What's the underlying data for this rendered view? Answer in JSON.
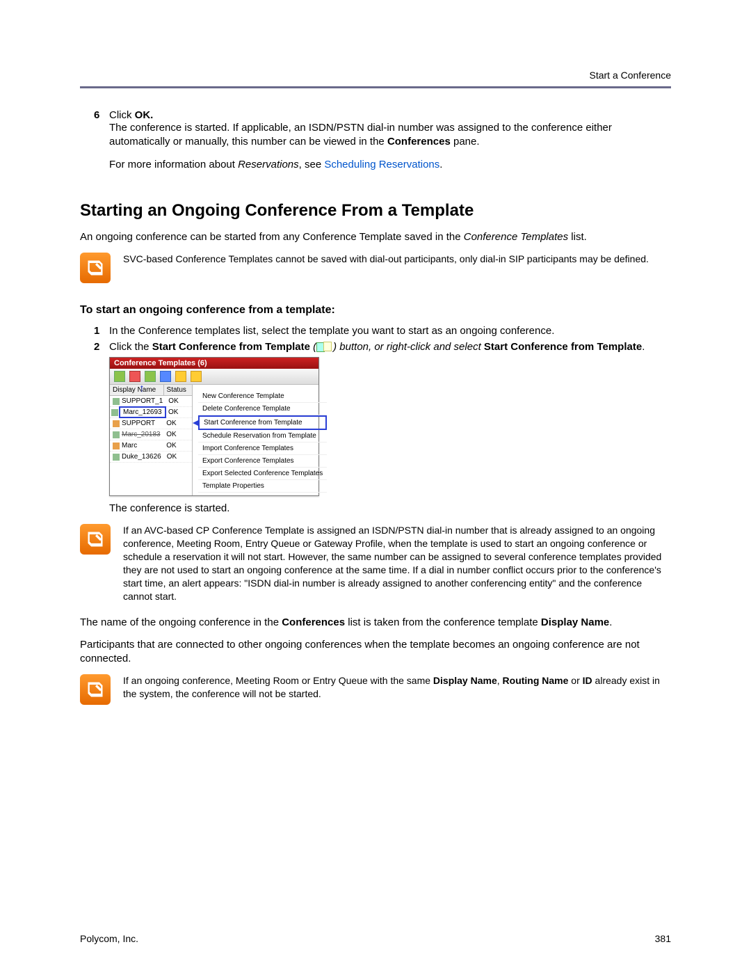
{
  "header": {
    "section": "Start a Conference"
  },
  "step6": {
    "num": "6",
    "label_prefix": "Click ",
    "label_bold": "OK.",
    "p1_a": "The conference is started. If applicable, an ISDN/PSTN dial-in number was assigned to the conference either automatically or manually, this number can be viewed in the ",
    "p1_bold": "Conferences",
    "p1_b": " pane.",
    "p2_a": "For more information about ",
    "p2_italic": "Reservations",
    "p2_b": ", see ",
    "p2_link": "Scheduling Reservations",
    "p2_c": "."
  },
  "h2": "Starting an Ongoing Conference From a Template",
  "intro_a": "An ongoing conference can be started from any Conference Template saved in the ",
  "intro_italic": "Conference Templates",
  "intro_b": " list.",
  "note1": "SVC-based Conference Templates cannot be saved with dial-out participants, only dial-in SIP participants may be defined.",
  "subhead": "To start an ongoing conference from a template:",
  "step1": {
    "num": "1",
    "text": "In the Conference templates list, select the template you want to start as an ongoing conference."
  },
  "step2": {
    "num": "2",
    "a": "Click the ",
    "b_bold": "Start Conference from Template",
    "c": " (",
    "d": ") button, or right-click and select ",
    "e_bold": "Start Conference from Template",
    "f": "."
  },
  "mock": {
    "title": "Conference Templates (6)",
    "col1": "Display Name",
    "col2": "Status",
    "rows": [
      {
        "name": "SUPPORT_1",
        "status": "OK"
      },
      {
        "name": "Marc_12693",
        "status": "OK"
      },
      {
        "name": "SUPPORT",
        "status": "OK"
      },
      {
        "name": "Marc_20183",
        "status": "OK"
      },
      {
        "name": "Marc",
        "status": "OK"
      },
      {
        "name": "Duke_13626",
        "status": "OK"
      }
    ],
    "menu": [
      "New Conference Template",
      "Delete Conference Template",
      "Start Conference from Template",
      "Schedule Reservation from Template",
      "Import Conference Templates",
      "Export Conference Templates",
      "Export Selected Conference Templates",
      "Template Properties"
    ]
  },
  "started": "The conference is started.",
  "note2": "If an AVC-based CP Conference Template is assigned an ISDN/PSTN dial-in number that is already assigned to an ongoing conference, Meeting Room, Entry Queue or Gateway Profile, when the template is used to start an ongoing conference or schedule a reservation it will not start. However, the same number can be assigned to several conference templates provided they are not used to start an ongoing conference at the same time. If a dial in number conflict occurs prior to the conference's start time, an alert appears: \"ISDN dial-in number is already assigned to another conferencing entity\" and the conference cannot start.",
  "p_after2_a": "The name of the ongoing conference in the ",
  "p_after2_bold1": "Conferences",
  "p_after2_b": " list is taken from the conference template ",
  "p_after2_bold2": "Display Name",
  "p_after2_c": ".",
  "p_after3": "Participants that are connected to other ongoing conferences when the template becomes an ongoing conference are not connected.",
  "note3_a": "If an ongoing conference, Meeting Room or Entry Queue with the same ",
  "note3_b1": "Display Name",
  "note3_b": ", ",
  "note3_b2": "Routing Name",
  "note3_c": " or ",
  "note3_b3": "ID",
  "note3_d": " already exist in the system, the conference will not be started.",
  "footer": {
    "left": "Polycom, Inc.",
    "right": "381"
  }
}
